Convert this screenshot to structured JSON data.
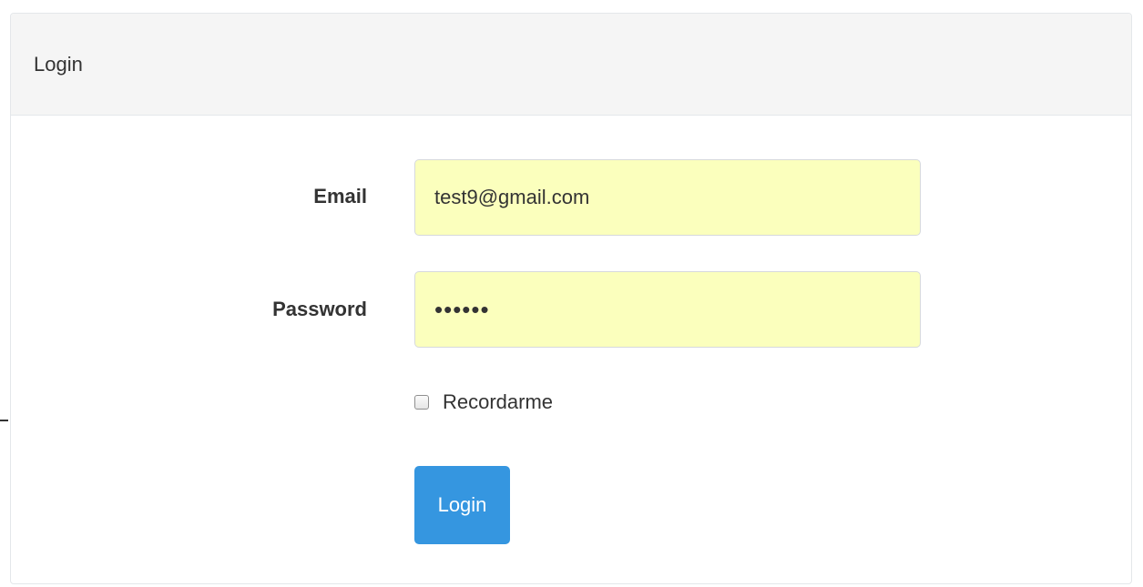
{
  "panel": {
    "title": "Login"
  },
  "form": {
    "email": {
      "label": "Email",
      "value": "test9@gmail.com"
    },
    "password": {
      "label": "Password",
      "value": "••••••"
    },
    "remember": {
      "label": "Recordarme",
      "checked": false
    },
    "submit_label": "Login"
  },
  "colors": {
    "primary_button": "#3596e0",
    "autofill_input_bg": "#fbffbd",
    "panel_heading_bg": "#f5f5f5"
  }
}
